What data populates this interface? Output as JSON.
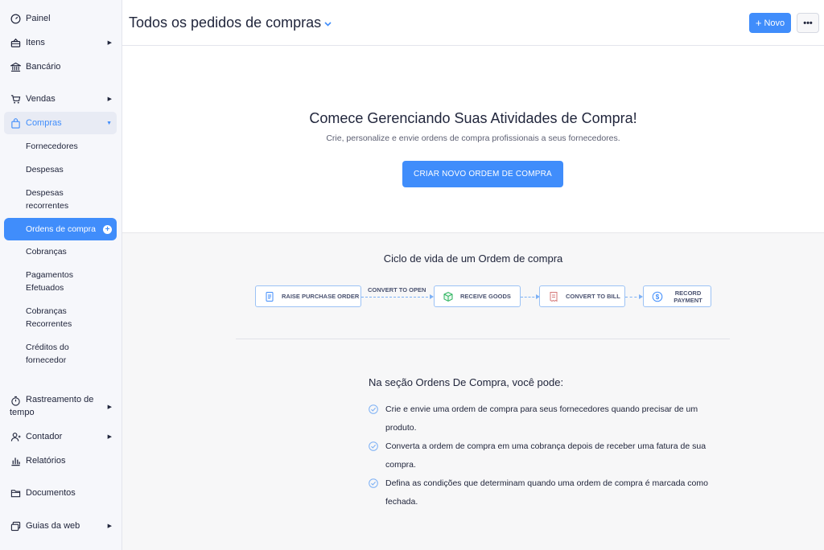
{
  "sidebar": {
    "items": [
      {
        "label": "Painel",
        "icon": "dashboard-icon"
      },
      {
        "label": "Itens",
        "icon": "basket-icon"
      },
      {
        "label": "Bancário",
        "icon": "bank-icon"
      },
      {
        "label": "Vendas",
        "icon": "cart-icon"
      },
      {
        "label": "Compras",
        "icon": "bag-icon"
      },
      {
        "label": "Rastreamento de tempo",
        "icon": "stopwatch-icon"
      },
      {
        "label": "Contador",
        "icon": "accountant-icon"
      },
      {
        "label": "Relatórios",
        "icon": "reports-icon"
      },
      {
        "label": "Documentos",
        "icon": "folder-icon"
      },
      {
        "label": "Guias da web",
        "icon": "web-tabs-icon"
      }
    ],
    "compras_sub": [
      {
        "label": "Fornecedores"
      },
      {
        "label": "Despesas"
      },
      {
        "label": "Despesas recorrentes"
      },
      {
        "label": "Ordens de compra"
      },
      {
        "label": "Cobranças"
      },
      {
        "label": "Pagamentos Efetuados"
      },
      {
        "label": "Cobranças Recorrentes"
      },
      {
        "label": "Créditos do fornecedor"
      }
    ]
  },
  "header": {
    "title": "Todos os pedidos de compras",
    "new_label": "Novo",
    "more_label": "•••"
  },
  "hero": {
    "title": "Comece Gerenciando Suas Atividades de Compra!",
    "subtitle": "Crie, personalize e envie ordens de compra profissionais a seus fornecedores.",
    "cta_label": "CRIAR NOVO ORDEM DE COMPRA"
  },
  "lifecycle": {
    "title": "Ciclo de vida de um Ordem de compra",
    "stages": [
      "RAISE PURCHASE ORDER",
      "RECEIVE GOODS",
      "CONVERT TO BILL",
      "RECORD PAYMENT"
    ],
    "transition_label": "CONVERT TO OPEN"
  },
  "features": {
    "title": "Na seção Ordens De Compra, você pode:",
    "bullets": [
      "Crie e envie uma ordem de compra para seus fornecedores quando precisar de um produto.",
      "Converta a ordem de compra em uma cobrança depois de receber uma fatura de sua compra.",
      "Defina as condições que determinam quando uma ordem de compra é marcada como fechada."
    ]
  },
  "colors": {
    "accent": "#408dfb",
    "sidebar_bg": "#f6f7fb",
    "text": "#21263c"
  }
}
